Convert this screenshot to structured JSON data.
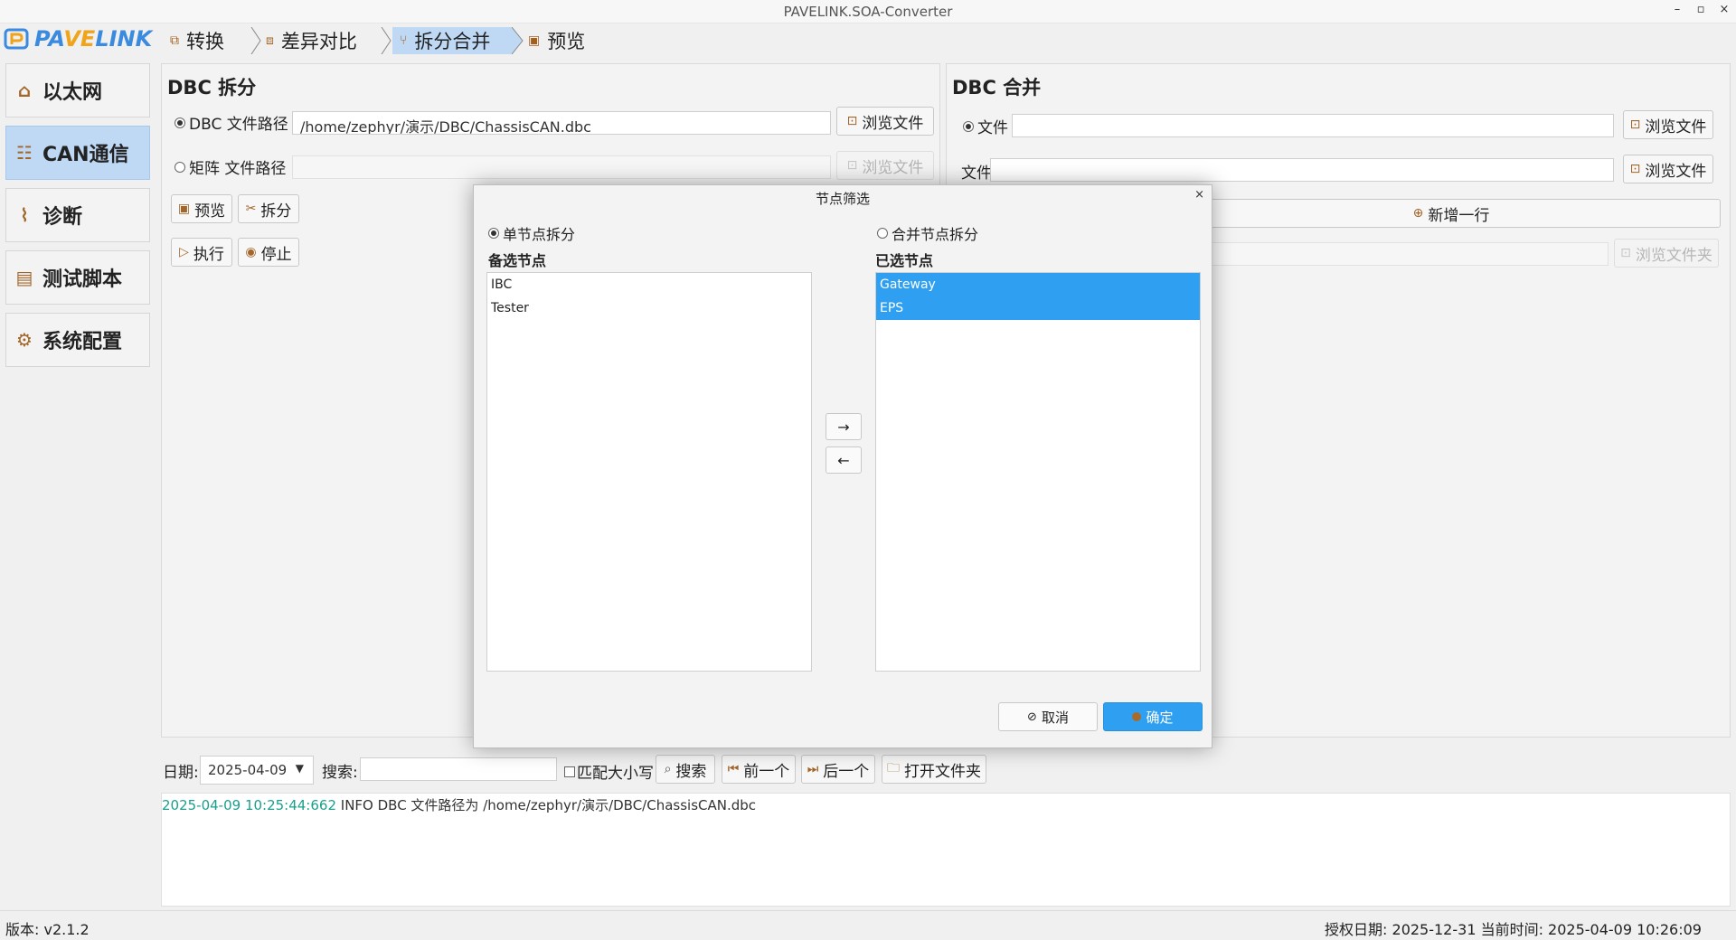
{
  "window": {
    "title": "PAVELINK.SOA-Converter",
    "controls": {
      "minimize": "–",
      "maximize": "▫",
      "close": "×"
    }
  },
  "logo": {
    "text_a": "PA",
    "text_b": "VE",
    "text_c": "LINK"
  },
  "tabs": [
    {
      "label": "转换",
      "icon": "convert-icon"
    },
    {
      "label": "差异对比",
      "icon": "compare-icon"
    },
    {
      "label": "拆分合并",
      "icon": "split-merge-icon",
      "active": true
    },
    {
      "label": "预览",
      "icon": "preview-icon"
    }
  ],
  "sidebar": {
    "items": [
      {
        "label": "以太网",
        "icon": "ethernet-icon"
      },
      {
        "label": "CAN通信",
        "icon": "can-icon",
        "active": true
      },
      {
        "label": "诊断",
        "icon": "diagnosis-icon"
      },
      {
        "label": "测试脚本",
        "icon": "script-icon"
      },
      {
        "label": "系统配置",
        "icon": "gear-icon"
      }
    ]
  },
  "split": {
    "title": "DBC 拆分",
    "dbc_path_label": "DBC 文件路径",
    "dbc_path_value": "/home/zephyr/演示/DBC/ChassisCAN.dbc",
    "matrix_path_label": "矩阵 文件路径",
    "matrix_path_value": "",
    "browse_label": "浏览文件",
    "preview_label": "预览",
    "split_label": "拆分",
    "execute_label": "执行",
    "stop_label": "停止"
  },
  "merge": {
    "title": "DBC 合并",
    "file_label_1": "文件",
    "file_label_2": "文件",
    "file_value_1": "",
    "file_value_2": "",
    "browse_label": "浏览文件",
    "add_row_label": "新增一行",
    "browse_folder_label": "浏览文件夹"
  },
  "logbar": {
    "date_label": "日期:",
    "date_value": "2025-04-09",
    "search_label": "搜索:",
    "search_value": "",
    "match_case_label": "匹配大小写",
    "search_button": "搜索",
    "prev_button": "前一个",
    "next_button": "后一个",
    "open_folder_button": "打开文件夹"
  },
  "log": {
    "timestamp": "2025-04-09 10:25:44:662",
    "message": " INFO  DBC 文件路径为 /home/zephyr/演示/DBC/ChassisCAN.dbc"
  },
  "status": {
    "version": "版本: v2.1.2",
    "right": "授权日期: 2025-12-31 当前时间: 2025-04-09 10:26:09"
  },
  "dialog": {
    "title": "节点筛选",
    "close": "×",
    "single_split_label": "单节点拆分",
    "merge_split_label": "合并节点拆分",
    "available_label": "备选节点",
    "selected_label": "已选节点",
    "available_nodes": [
      "IBC",
      "Tester"
    ],
    "selected_nodes": [
      "Gateway",
      "EPS"
    ],
    "move_right": "→",
    "move_left": "←",
    "cancel_label": "取消",
    "ok_label": "确定",
    "accent_color": "#2f9ff2"
  }
}
